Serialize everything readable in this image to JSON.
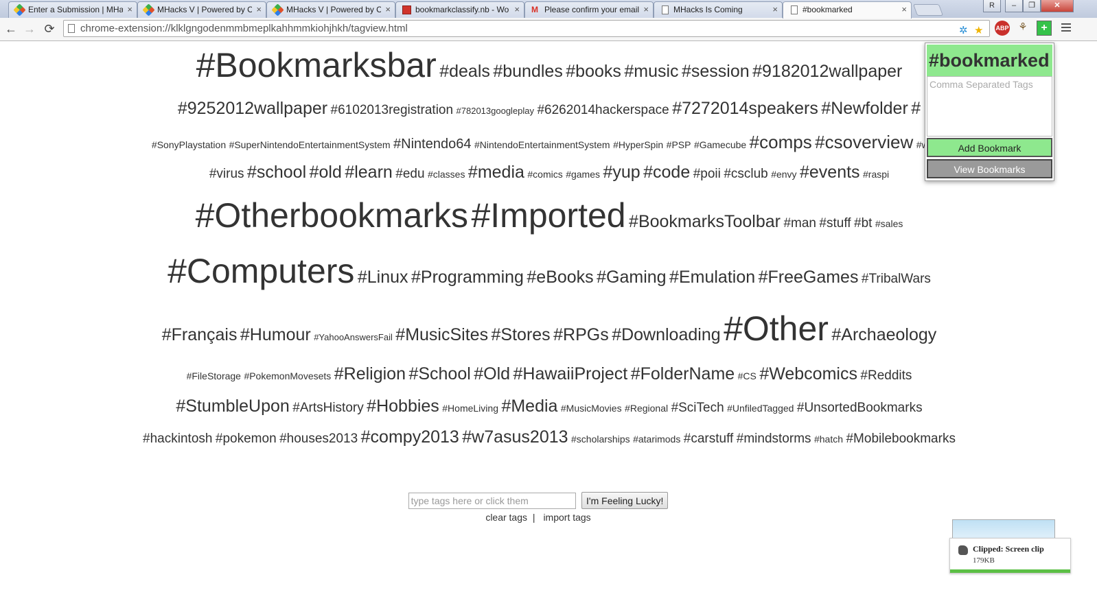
{
  "tabs": [
    {
      "title": "Enter a Submission | MHa",
      "favicon": "pinwheel-icon"
    },
    {
      "title": "MHacks V | Powered by Cl",
      "favicon": "pinwheel-icon"
    },
    {
      "title": "MHacks V | Powered by Cl",
      "favicon": "pinwheel-icon"
    },
    {
      "title": "bookmarkclassify.nb - Wo",
      "favicon": "wolfram-icon"
    },
    {
      "title": "Please confirm your email",
      "favicon": "gmail-icon"
    },
    {
      "title": "MHacks Is Coming",
      "favicon": "document-icon"
    },
    {
      "title": "#bookmarked",
      "favicon": "document-icon",
      "active": true
    }
  ],
  "tab_close_glyph": "×",
  "window_controls": {
    "user": "R",
    "minimize": "–",
    "restore": "❐",
    "close": "✕"
  },
  "toolbar": {
    "url": "chrome-extension://klklgngodenmmbmeplkahhmmkiohjhkh/tagview.html",
    "back": "←",
    "forward": "→",
    "reload": "⟳",
    "abp_label": "ABP",
    "bookmarked_ext_label": "+"
  },
  "cloud": [
    [
      [
        "#Bookmarksbar",
        50
      ],
      [
        "#deals",
        25
      ],
      [
        "#bundles",
        25
      ],
      [
        "#books",
        25
      ],
      [
        "#music",
        25
      ],
      [
        "#session",
        25
      ],
      [
        "#9182012wallpaper",
        25
      ]
    ],
    [
      [
        "#9252012wallpaper",
        25
      ],
      [
        "#6102013registration",
        19
      ],
      [
        "#782013googleplay",
        13
      ],
      [
        "#6262014hackerspace",
        19
      ],
      [
        "#7272014speakers",
        25
      ],
      [
        "#Newfolder",
        25
      ],
      [
        "#",
        25
      ]
    ],
    [
      [
        "#SonyPlaystation",
        14
      ],
      [
        "#SuperNintendoEntertainmentSystem",
        14
      ],
      [
        "#Nintendo64",
        20
      ],
      [
        "#NintendoEntertainmentSystem",
        14
      ],
      [
        "#HyperSpin",
        14
      ],
      [
        "#PSP",
        14
      ],
      [
        "#Gamecube",
        14
      ],
      [
        "#comps",
        26
      ],
      [
        "#csoverview",
        26
      ],
      [
        "#windo",
        14
      ]
    ],
    [
      [
        "#virus",
        19
      ],
      [
        "#school",
        25
      ],
      [
        "#old",
        25
      ],
      [
        "#learn",
        25
      ],
      [
        "#edu",
        19
      ],
      [
        "#classes",
        14
      ],
      [
        "#media",
        25
      ],
      [
        "#comics",
        14
      ],
      [
        "#games",
        14
      ],
      [
        "#yup",
        25
      ],
      [
        "#code",
        25
      ],
      [
        "#poii",
        19
      ],
      [
        "#csclub",
        19
      ],
      [
        "#envy",
        14
      ],
      [
        "#events",
        25
      ],
      [
        "#raspi",
        14
      ]
    ],
    [
      [
        "#Otherbookmarks",
        50
      ],
      [
        "#Imported",
        50
      ],
      [
        "#BookmarksToolbar",
        25
      ],
      [
        "#man",
        19
      ],
      [
        "#stuff",
        19
      ],
      [
        "#bt",
        19
      ],
      [
        "#sales",
        14
      ]
    ],
    [
      [
        "#Computers",
        50
      ],
      [
        "#Linux",
        25
      ],
      [
        "#Programming",
        25
      ],
      [
        "#eBooks",
        25
      ],
      [
        "#Gaming",
        25
      ],
      [
        "#Emulation",
        25
      ],
      [
        "#FreeGames",
        25
      ],
      [
        "#TribalWars",
        19
      ]
    ],
    [
      [
        "#Français",
        25
      ],
      [
        "#Humour",
        25
      ],
      [
        "#YahooAnswersFail",
        13
      ],
      [
        "#MusicSites",
        25
      ],
      [
        "#Stores",
        25
      ],
      [
        "#RPGs",
        25
      ],
      [
        "#Downloading",
        25
      ],
      [
        "#Other",
        50
      ],
      [
        "#Archaeology",
        25
      ]
    ],
    [
      [
        "#FileStorage",
        14
      ],
      [
        "#PokemonMovesets",
        14
      ],
      [
        "#Religion",
        25
      ],
      [
        "#School",
        25
      ],
      [
        "#Old",
        25
      ],
      [
        "#HawaiiProject",
        25
      ],
      [
        "#FolderName",
        25
      ],
      [
        "#CS",
        14
      ],
      [
        "#Webcomics",
        25
      ],
      [
        "#Reddits",
        19
      ]
    ],
    [
      [
        "#StumbleUpon",
        25
      ],
      [
        "#ArtsHistory",
        19
      ],
      [
        "#Hobbies",
        25
      ],
      [
        "#HomeLiving",
        14
      ],
      [
        "#Media",
        25
      ],
      [
        "#MusicMovies",
        14
      ],
      [
        "#Regional",
        14
      ],
      [
        "#SciTech",
        19
      ],
      [
        "#UnfiledTagged",
        14
      ],
      [
        "#UnsortedBookmarks",
        19
      ]
    ],
    [
      [
        "#hackintosh",
        19
      ],
      [
        "#pokemon",
        19
      ],
      [
        "#houses2013",
        19
      ],
      [
        "#compy2013",
        25
      ],
      [
        "#w7asus2013",
        25
      ],
      [
        "#scholarships",
        14
      ],
      [
        "#atarimods",
        14
      ],
      [
        "#carstuff",
        19
      ],
      [
        "#mindstorms",
        19
      ],
      [
        "#hatch",
        14
      ],
      [
        "#Mobilebookmarks",
        19
      ]
    ]
  ],
  "search": {
    "placeholder": "type tags here or click them",
    "value": "",
    "button": "I'm Feeling Lucky!"
  },
  "links": {
    "clear": "clear tags",
    "separator": "|",
    "import": "import tags"
  },
  "popup": {
    "title": "#bookmarked",
    "tags_placeholder": "Comma Separated Tags",
    "add_button": "Add Bookmark",
    "view_button": "View Bookmarks",
    "accent_color": "#8ee88e"
  },
  "notification": {
    "title": "Clipped: Screen clip",
    "size": "179KB",
    "icon": "evernote-icon"
  }
}
